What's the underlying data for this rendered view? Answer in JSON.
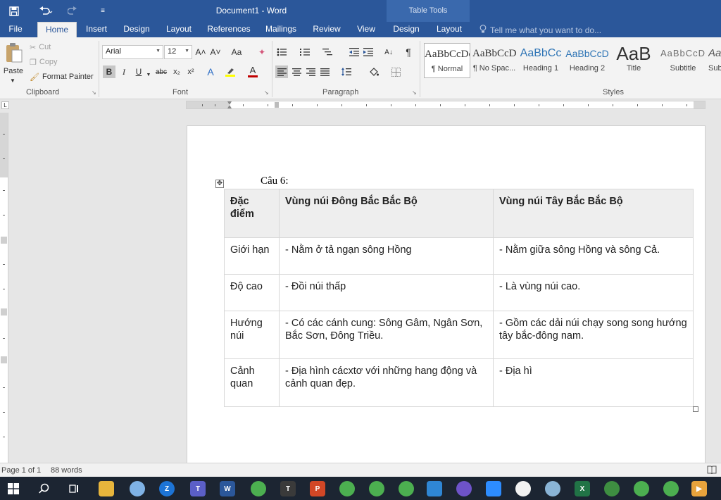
{
  "window": {
    "title": "Document1 - Word",
    "contextual_group": "Table Tools",
    "accent_color": "#2b579a"
  },
  "quick_access": {
    "save_icon": "floppy-disk-icon",
    "undo_icon": "undo-arrow-icon",
    "redo_icon": "redo-arrow-icon",
    "customize_icon": "customize-dropdown-icon"
  },
  "tabs": [
    {
      "label": "File",
      "active": false
    },
    {
      "label": "Home",
      "active": true
    },
    {
      "label": "Insert",
      "active": false
    },
    {
      "label": "Design",
      "active": false
    },
    {
      "label": "Layout",
      "active": false
    },
    {
      "label": "References",
      "active": false
    },
    {
      "label": "Mailings",
      "active": false
    },
    {
      "label": "Review",
      "active": false
    },
    {
      "label": "View",
      "active": false
    },
    {
      "label": "Design",
      "active": false
    },
    {
      "label": "Layout",
      "active": false
    }
  ],
  "tell_me": "Tell me what you want to do...",
  "ribbon": {
    "clipboard": {
      "label": "Clipboard",
      "paste": "Paste",
      "cut": "Cut",
      "copy": "Copy",
      "format_painter": "Format Painter"
    },
    "font": {
      "label": "Font",
      "font_name": "Arial",
      "font_size": "12",
      "bold": "B",
      "italic": "I",
      "underline": "U",
      "strikethrough": "abc",
      "subscript": "x₂",
      "superscript": "x²",
      "grow": "A˄",
      "shrink": "A˅",
      "change_case": "Aa",
      "text_effects": "A",
      "font_color_accent": "#c00000",
      "highlight_accent": "#ffff00"
    },
    "paragraph": {
      "label": "Paragraph",
      "show_marks": "¶"
    },
    "styles": {
      "label": "Styles",
      "items": [
        {
          "sample": "AaBbCcDc",
          "name": "¶ Normal"
        },
        {
          "sample": "AaBbCcDc",
          "name": "¶ No Spac..."
        },
        {
          "sample": "AaBbCc",
          "name": "Heading 1"
        },
        {
          "sample": "AaBbCcD",
          "name": "Heading 2"
        },
        {
          "sample": "AaB",
          "name": "Title"
        },
        {
          "sample": "AaBbCcD",
          "name": "Subtitle"
        },
        {
          "sample": "AaBbCcDc",
          "name": "Subtle"
        }
      ]
    }
  },
  "document": {
    "question": "Câu 6:",
    "table": {
      "headers": [
        "Đặc điểm",
        "Vùng núi Đông Bắc Bắc Bộ",
        "Vùng núi Tây Bắc Bắc Bộ"
      ],
      "rows": [
        [
          "Giới hạn",
          "- Nằm ở tả ngạn sông Hồng",
          "- Nằm giữa sông Hồng và sông Cả."
        ],
        [
          "Độ cao",
          "- Đồi núi thấp",
          "- Là vùng núi cao."
        ],
        [
          "Hướng núi",
          "- Có các cánh cung: Sông Gâm, Ngân Sơn, Bắc Sơn, Đông Triều.",
          "- Gồm các dải núi chạy song song hướng tây bắc-đông nam."
        ],
        [
          "Cảnh quan",
          "- Địa hình cácxtơ với những hang động và cảnh quan đẹp.",
          "- Địa hì"
        ]
      ]
    }
  },
  "status": {
    "page": "Page 1 of 1",
    "words": "88 words"
  },
  "taskbar": {
    "icons": [
      "windows-start-icon",
      "search-icon",
      "task-view-icon",
      "file-explorer-icon",
      "paint-app-icon",
      "zalo-icon",
      "teams-icon",
      "word-icon",
      "chrome-icon",
      "text-editor-icon",
      "powerpoint-icon",
      "chrome-icon",
      "chrome-icon",
      "chrome-icon",
      "store-icon",
      "feather-app-icon",
      "zoom-icon",
      "picasa-icon",
      "paint-icon",
      "excel-icon",
      "excel-chrome-icon",
      "chrome-icon",
      "chrome-icon",
      "video-player-icon"
    ]
  }
}
